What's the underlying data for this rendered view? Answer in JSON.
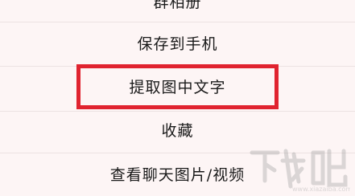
{
  "menu": {
    "items": [
      {
        "label": "群相册"
      },
      {
        "label": "保存到手机"
      },
      {
        "label": "提取图中文字"
      },
      {
        "label": "收藏"
      },
      {
        "label": "查看聊天图片/视频"
      }
    ]
  },
  "highlight": {
    "color": "#e0232f",
    "target": "提取图中文字"
  },
  "watermark": {
    "brand_text": "下载吧"
  }
}
